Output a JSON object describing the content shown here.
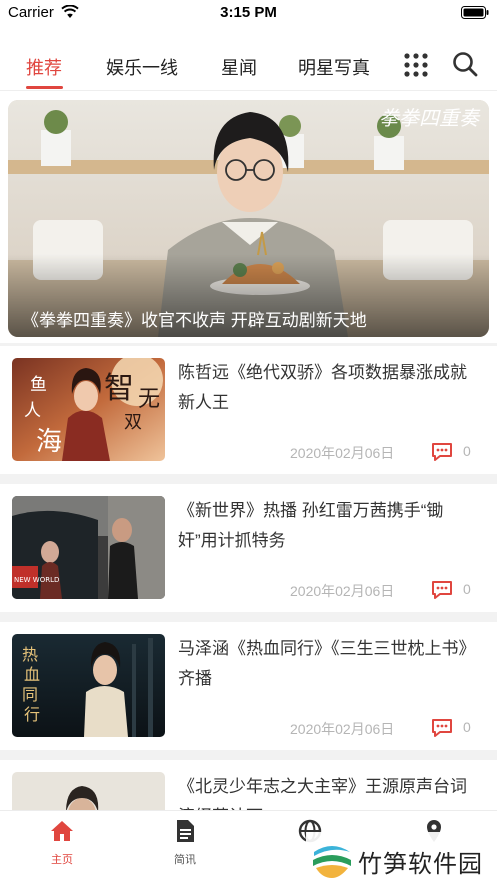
{
  "status_bar": {
    "carrier": "Carrier",
    "time": "3:15 PM"
  },
  "tabs": [
    {
      "label": "推荐",
      "active": true
    },
    {
      "label": "娱乐一线",
      "active": false
    },
    {
      "label": "星闻",
      "active": false
    },
    {
      "label": "明星写真",
      "active": false
    }
  ],
  "tab_icons": {
    "menu": "grid-icon",
    "search": "search-icon"
  },
  "banner": {
    "title": "《拳拳四重奏》收官不收声 开辟互动剧新天地",
    "logo": "拳拳四重奏"
  },
  "news": [
    {
      "title": "陈哲远《绝代双骄》各项数据暴涨成就新人王",
      "date": "2020年02月06日",
      "comments": "0",
      "thumb_poster": {
        "chars": [
          "鱼",
          "人",
          "海",
          "智",
          "无",
          "双"
        ]
      }
    },
    {
      "title": "《新世界》热播 孙红雷万茜携手“锄奸”用计抓特务",
      "date": "2020年02月06日",
      "comments": "0",
      "thumb_poster": {
        "badge": "NEW WORLD"
      }
    },
    {
      "title": "马泽涵《热血同行》《三生三世枕上书》齐播",
      "date": "2020年02月06日",
      "comments": "0",
      "thumb_poster": {
        "chars": [
          "热",
          "血",
          "同",
          "行"
        ]
      }
    },
    {
      "title": "《北灵少年志之大主宰》王源原声台词演绎获认可",
      "date": "",
      "comments": "",
      "thumb_poster": {}
    }
  ],
  "bottom_nav": [
    {
      "label": "主页",
      "icon": "home-icon",
      "active": true
    },
    {
      "label": "简讯",
      "icon": "document-icon",
      "active": false
    },
    {
      "label": "",
      "icon": "globe-icon",
      "active": false
    },
    {
      "label": "",
      "icon": "location-icon",
      "active": false
    }
  ],
  "watermark": {
    "text": "竹笋软件园"
  },
  "colors": {
    "accent": "#e0463f",
    "separator": "#f2f2f2",
    "meta_text": "#b5b5b5"
  }
}
